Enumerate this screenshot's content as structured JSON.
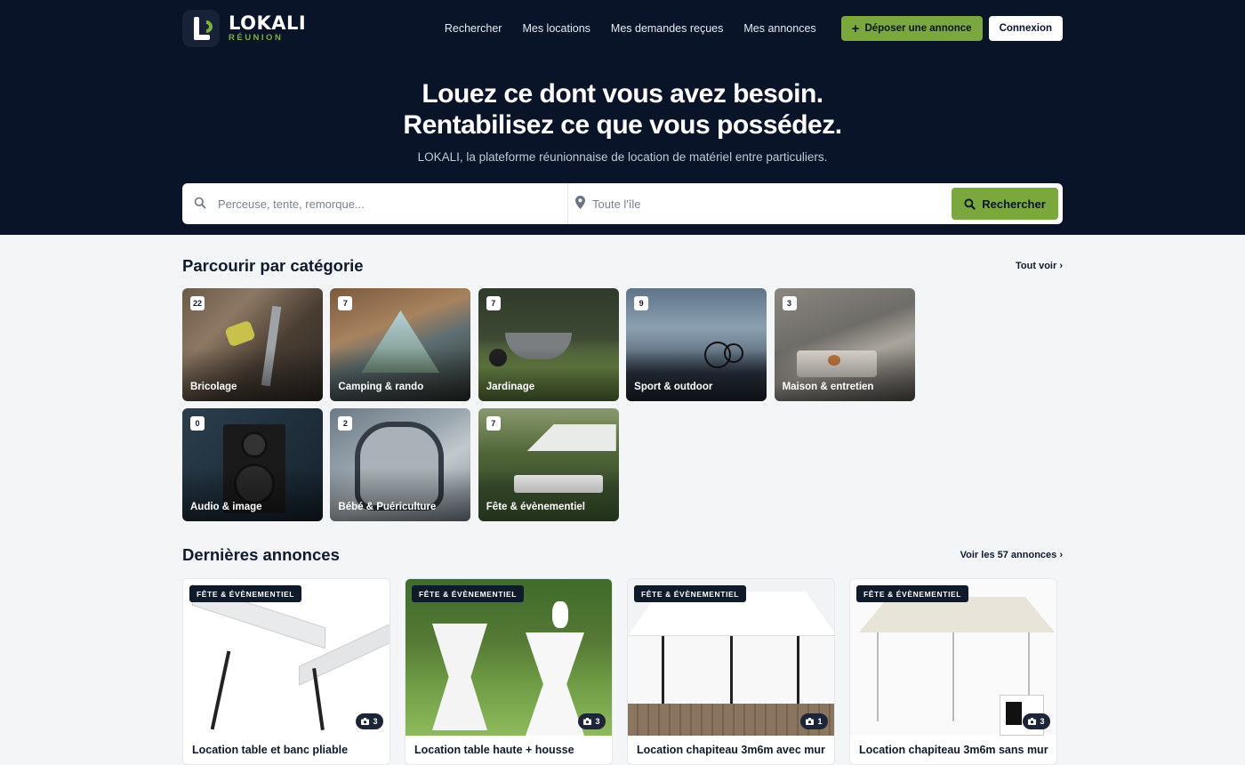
{
  "brand": {
    "name": "LOKALI",
    "region": "RÉUNION"
  },
  "nav": {
    "links": [
      "Rechercher",
      "Mes locations",
      "Mes demandes reçues",
      "Mes annonces"
    ],
    "post_label": "Déposer une annonce",
    "login_label": "Connexion"
  },
  "hero": {
    "line1": "Louez ce dont vous avez besoin.",
    "line2": "Rentabilisez ce que vous possédez.",
    "subtitle": "LOKALI, la plateforme réunionnaise de location de matériel entre particuliers."
  },
  "search": {
    "query_placeholder": "Perceuse, tente, remorque...",
    "location_placeholder": "Toute l'île",
    "button_label": "Rechercher"
  },
  "categories_section": {
    "title": "Parcourir par catégorie",
    "link": "Tout voir",
    "items": [
      {
        "label": "Bricolage",
        "count": "22"
      },
      {
        "label": "Camping & rando",
        "count": "7"
      },
      {
        "label": "Jardinage",
        "count": "7"
      },
      {
        "label": "Sport & outdoor",
        "count": "9"
      },
      {
        "label": "Maison & entretien",
        "count": "3"
      },
      {
        "label": "Audio & image",
        "count": "0"
      },
      {
        "label": "Bébé & Puériculture",
        "count": "2"
      },
      {
        "label": "Fête & évènementiel",
        "count": "7"
      }
    ]
  },
  "listings_section": {
    "title": "Dernières annonces",
    "link": "Voir les 57 annonces",
    "items": [
      {
        "category": "FÊTE & ÉVÈNEMENTIEL",
        "photos": "3",
        "title": "Location table et banc pliable"
      },
      {
        "category": "FÊTE & ÉVÈNEMENTIEL",
        "photos": "3",
        "title": "Location table haute + housse"
      },
      {
        "category": "FÊTE & ÉVÈNEMENTIEL",
        "photos": "1",
        "title": "Location chapiteau 3m6m avec mur"
      },
      {
        "category": "FÊTE & ÉVÈNEMENTIEL",
        "photos": "3",
        "title": "Location chapiteau 3m6m sans mur"
      }
    ]
  },
  "colors": {
    "navy": "#0a1428",
    "accent": "#7aa83c",
    "background": "#f3f5f7"
  }
}
